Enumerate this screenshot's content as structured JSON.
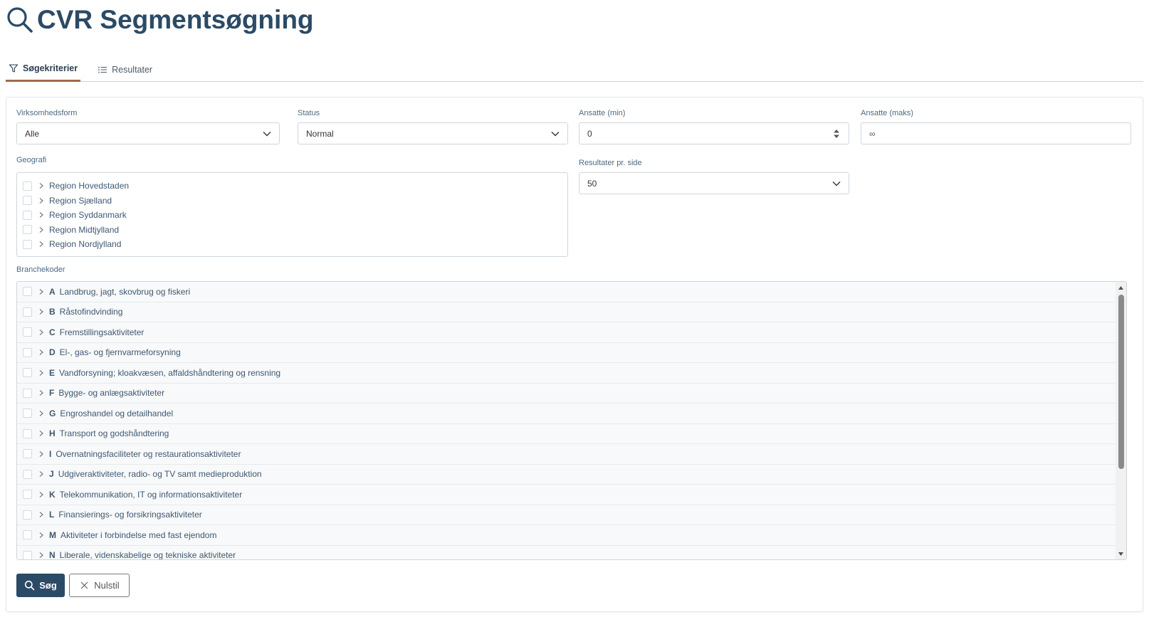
{
  "header": {
    "title": "CVR Segmentsøgning",
    "icon": "search-icon"
  },
  "tabs": [
    {
      "label": "Søgekriterier",
      "icon": "filter-icon",
      "active": true
    },
    {
      "label": "Resultater",
      "icon": "list-icon",
      "active": false
    }
  ],
  "form": {
    "virksomhedsform": {
      "label": "Virksomhedsform",
      "value": "Alle"
    },
    "status": {
      "label": "Status",
      "value": "Normal"
    },
    "ansatte_min": {
      "label": "Ansatte (min)",
      "value": "0"
    },
    "ansatte_maks": {
      "label": "Ansatte (maks)",
      "placeholder": "∞"
    },
    "resultater_pr_side": {
      "label": "Resultater pr. side",
      "value": "50"
    },
    "geografi": {
      "label": "Geografi",
      "items": [
        "Region Hovedstaden",
        "Region Sjælland",
        "Region Syddanmark",
        "Region Midtjylland",
        "Region Nordjylland"
      ]
    },
    "branchekoder": {
      "label": "Branchekoder",
      "items": [
        {
          "code": "A",
          "label": "Landbrug, jagt, skovbrug og fiskeri"
        },
        {
          "code": "B",
          "label": "Råstofindvinding"
        },
        {
          "code": "C",
          "label": "Fremstillingsaktiviteter"
        },
        {
          "code": "D",
          "label": "El-, gas- og fjernvarmeforsyning"
        },
        {
          "code": "E",
          "label": "Vandforsyning; kloakvæsen, affaldshåndtering og rensning"
        },
        {
          "code": "F",
          "label": "Bygge- og anlægsaktiviteter"
        },
        {
          "code": "G",
          "label": "Engroshandel og detailhandel"
        },
        {
          "code": "H",
          "label": "Transport og godshåndtering"
        },
        {
          "code": "I",
          "label": "Overnatningsfaciliteter og restaurationsaktiviteter"
        },
        {
          "code": "J",
          "label": "Udgiveraktiviteter, radio- og TV samt medieproduktion"
        },
        {
          "code": "K",
          "label": "Telekommunikation, IT og informationsaktiviteter"
        },
        {
          "code": "L",
          "label": "Finansierings- og forsikringsaktiviteter"
        },
        {
          "code": "M",
          "label": "Aktiviteter i forbindelse med fast ejendom"
        },
        {
          "code": "N",
          "label": "Liberale, videnskabelige og tekniske aktiviteter"
        }
      ]
    }
  },
  "actions": {
    "search_label": "Søg",
    "reset_label": "Nulstil"
  },
  "colors": {
    "primary": "#2b4a66",
    "tab_underline": "#a06a45",
    "label": "#4b6a86"
  }
}
